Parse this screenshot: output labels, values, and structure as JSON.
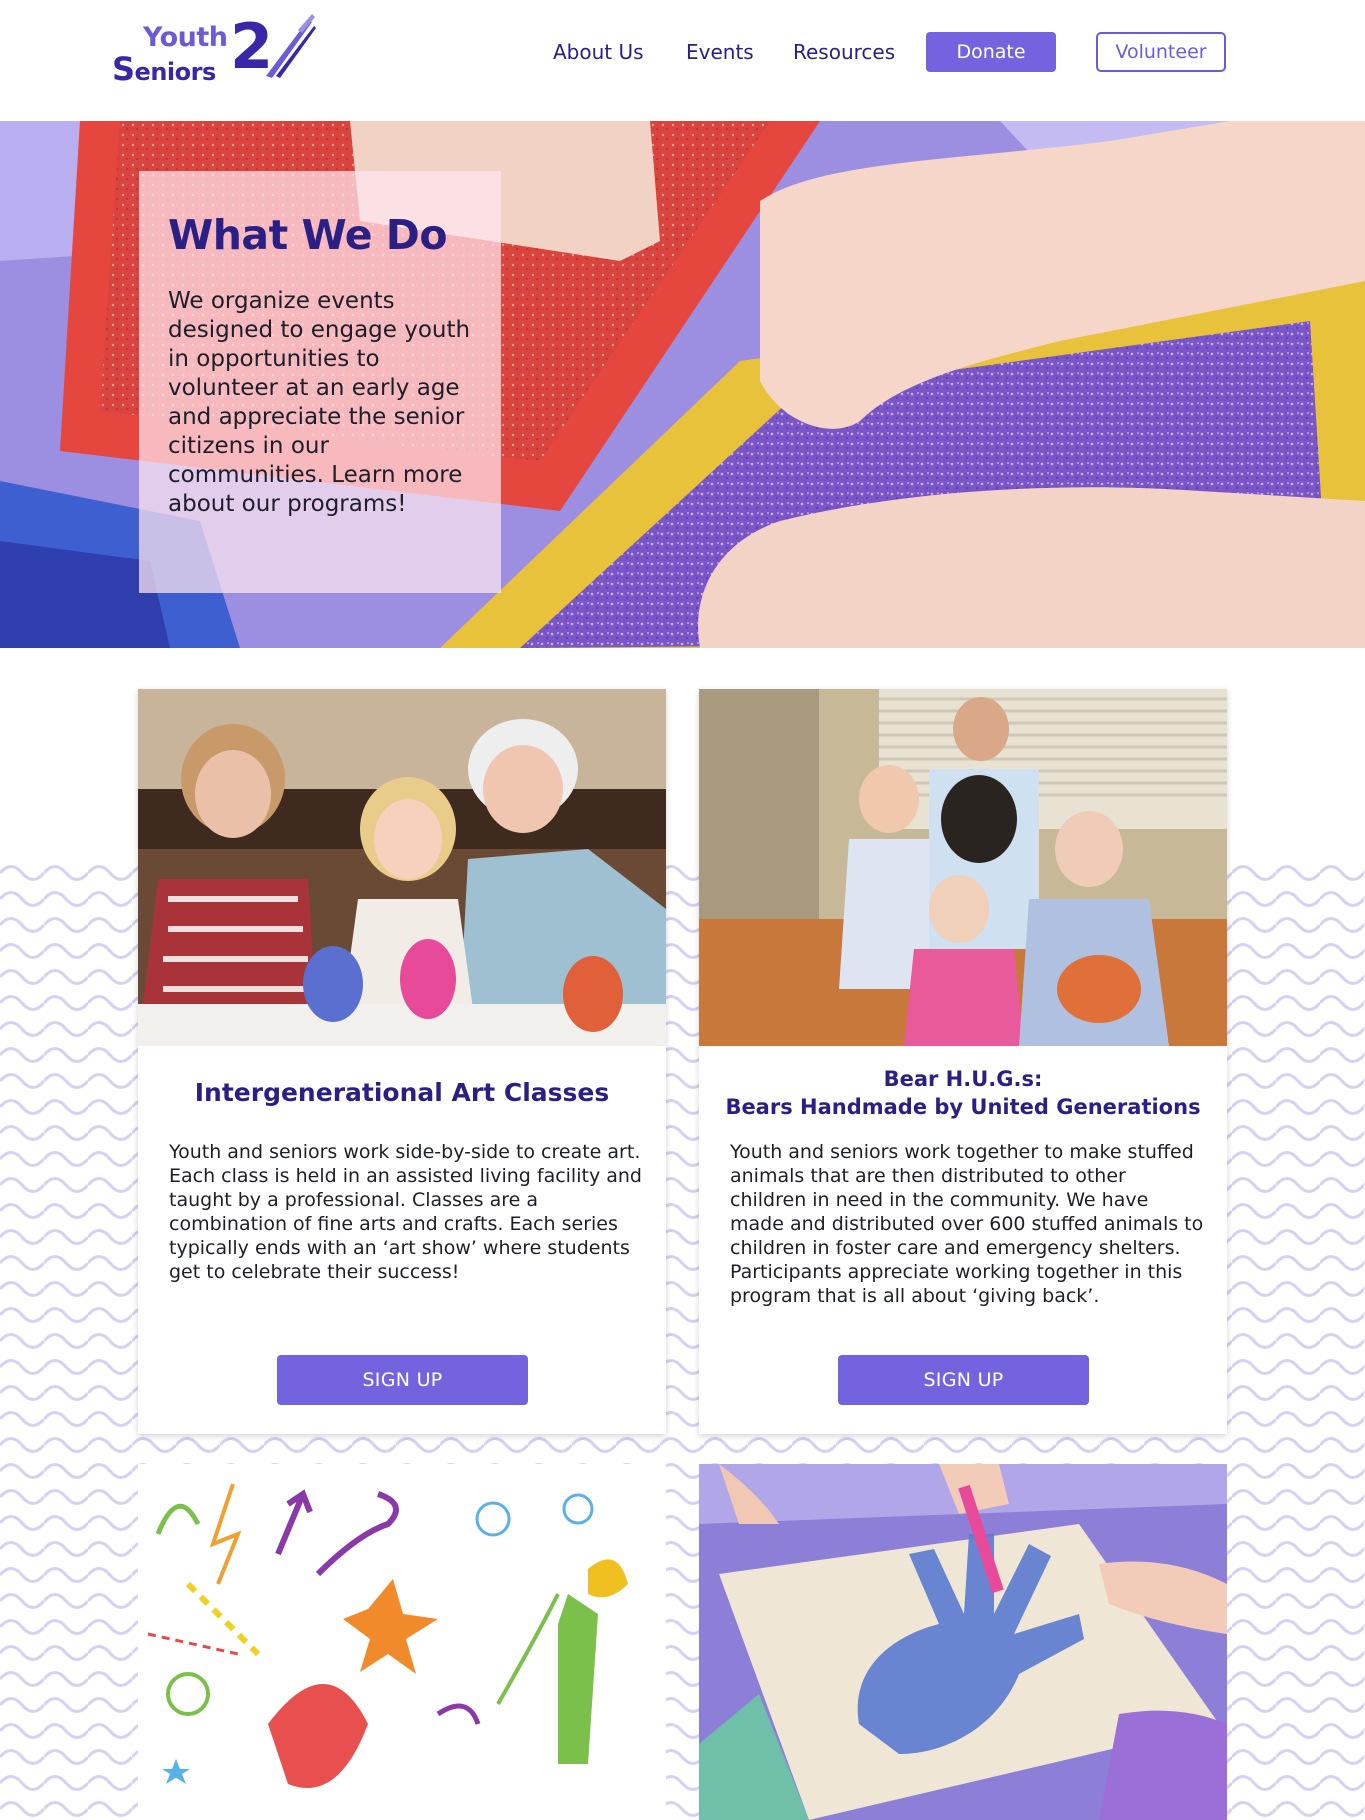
{
  "header": {
    "logo": {
      "word1": "Youth",
      "word2_initial": "S",
      "word2_rest": "eniors",
      "numeral": "2"
    },
    "nav": [
      {
        "label": "About Us"
      },
      {
        "label": "Events"
      },
      {
        "label": "Resources"
      }
    ],
    "donate_label": "Donate",
    "volunteer_label": "Volunteer"
  },
  "hero": {
    "title": "What We Do",
    "text": "We organize events designed to engage youth in opportunities to volunteer at an early age and appreciate the senior citizens in our communities. Learn more about our programs!"
  },
  "programs": [
    {
      "title": "Intergenerational Art Classes",
      "description": "Youth and seniors work side-by-side to create art. Each class is held in an assisted living facility and taught by a professional. Classes are a combination of fine arts and crafts. Each series typically ends with an ‘art show’ where students get to celebrate their success!",
      "button_label": "SIGN UP"
    },
    {
      "title_line1": "Bear H.U.G.s:",
      "title_line2": "Bears Handmade by United Generations",
      "description": "Youth and seniors work together to make stuffed animals that are then distributed to other children in need in the community.  We have made and distributed over 600 stuffed animals to children in foster care and emergency shelters. Participants appreciate working together in this program that is all about ‘giving back’.",
      "button_label": "SIGN UP"
    }
  ],
  "colors": {
    "brand_dark": "#2a1f85",
    "brand_accent": "#7363de",
    "wave": "#d6d0f2"
  }
}
